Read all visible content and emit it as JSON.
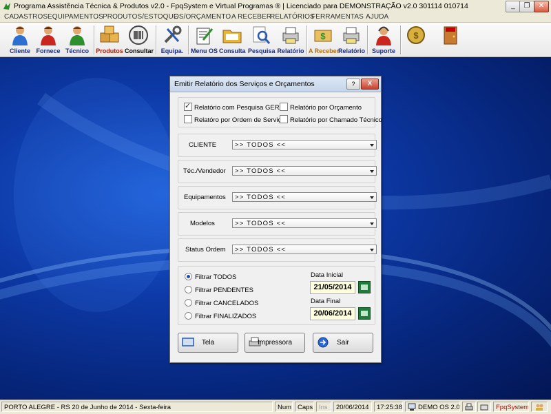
{
  "window": {
    "title": "Programa Assistência Técnica & Produtos v2.0 - FpqSystem e Virtual Programas ® | Licenciado para  DEMONSTRAÇÃO v2.0 301114 010714",
    "minimize": "_",
    "restore": "❐",
    "close": "✕"
  },
  "menu": [
    "CADASTROS",
    "EQUIPAMENTOS",
    "PRODUTOS/ESTOQUE",
    "OS/ORÇAMENTO",
    "A RECEBER",
    "RELATÓRIOS",
    "FERRAMENTAS",
    "AJUDA"
  ],
  "toolbar": {
    "cliente": "Cliente",
    "fornece": "Fornece",
    "tecnico": "Técnico",
    "produtos": "Produtos",
    "consultar": "Consultar",
    "equipa": "Equipa.",
    "menu_os": "Menu OS",
    "consulta": "Consulta",
    "pesquisa": "Pesquisa",
    "relatorio": "Relatório",
    "a_receber": "A Receber",
    "relatorio2": "Relatório",
    "suporte": "Suporte"
  },
  "dialog": {
    "title": "Emitir Relatório dos Serviços e Orçamentos",
    "help": "?",
    "close": "X",
    "checks": [
      {
        "label": "Relatório com Pesquisa GERAL",
        "checked": true
      },
      {
        "label": "Relatório por Orçamento",
        "checked": false
      },
      {
        "label": "Relatóro por Ordem de Serviço",
        "checked": false
      },
      {
        "label": "Relatório por Chamado Técnico",
        "checked": false
      }
    ],
    "fields": [
      {
        "label": "CLIENTE",
        "value": ">> TODOS <<"
      },
      {
        "label": "Téc./Vendedor",
        "value": ">> TODOS <<"
      },
      {
        "label": "Equipamentos",
        "value": ">> TODOS <<"
      },
      {
        "label": "Modelos",
        "value": ">> TODOS <<"
      },
      {
        "label": "Status Ordem",
        "value": ">> TODOS <<"
      }
    ],
    "filters": [
      {
        "label": "Filtrar TODOS",
        "selected": true
      },
      {
        "label": "Filtrar PENDENTES",
        "selected": false
      },
      {
        "label": "Filtrar CANCELADOS",
        "selected": false
      },
      {
        "label": "Filtrar FINALIZADOS",
        "selected": false
      }
    ],
    "data_inicial_label": "Data Inicial",
    "data_inicial": "21/05/2014",
    "data_final_label": "Data Final",
    "data_final": "20/06/2014",
    "btn_tela": "Tela",
    "btn_impressora": "Impressora",
    "btn_sair": "Sair"
  },
  "status": {
    "location": "PORTO ALEGRE - RS 20 de Junho de 2014 - Sexta-feira",
    "num": "Num",
    "caps": "Caps",
    "ins": "Ins",
    "date": "20/06/2014",
    "time": "17:25:38",
    "version": "DEMO OS 2.0",
    "brand": "FpqSystem"
  },
  "colors": {
    "desktop": "#0d3aa8",
    "accent": "#1a2a7a",
    "brand_red": "#c00000"
  }
}
